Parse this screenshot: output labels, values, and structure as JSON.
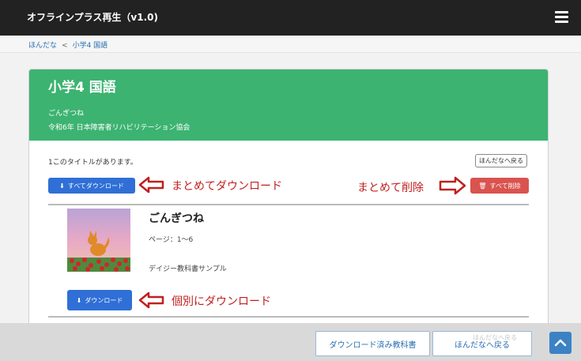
{
  "app": {
    "title": "オフラインプラス再生（v1.0)"
  },
  "breadcrumb": {
    "root": "ほんだな",
    "separator": "<",
    "current": "小学4 国語"
  },
  "header": {
    "grade_subject": "小学4 国語",
    "book_name": "ごんぎつね",
    "publisher": "令和6年 日本障害者リハビリテーション協会"
  },
  "toolbar": {
    "count_text": "1このタイトルがあります。",
    "back_label": "ほんだなへ戻る",
    "download_all_label": "すべてダウンロード",
    "delete_all_label": "すべて削除"
  },
  "annotations": {
    "download_all": "まとめてダウンロード",
    "delete_all": "まとめて削除",
    "download_one": "個別にダウンロード"
  },
  "book": {
    "title": "ごんぎつね",
    "pages": "ページ：1〜6",
    "sample_label": "デイジー教科書サンプル",
    "download_label": "ダウンロード"
  },
  "footer": {
    "downloaded_textbooks_label": "ダウンロード済み教科書",
    "back_to_shelf_label": "ほんだなへ戻る",
    "ghost_text": "ほんだなへ戻る"
  },
  "icons": {
    "menu": "hamburger-icon",
    "download": "download-icon",
    "trash": "trash-icon",
    "arrow": "left-arrow-icon",
    "scroll_top": "chevron-up-icon"
  },
  "colors": {
    "header_green": "#3cb371",
    "primary_blue": "#2f6fd6",
    "danger_red": "#d9534f",
    "annotation_red": "#c0201f",
    "topbar": "#222222"
  }
}
